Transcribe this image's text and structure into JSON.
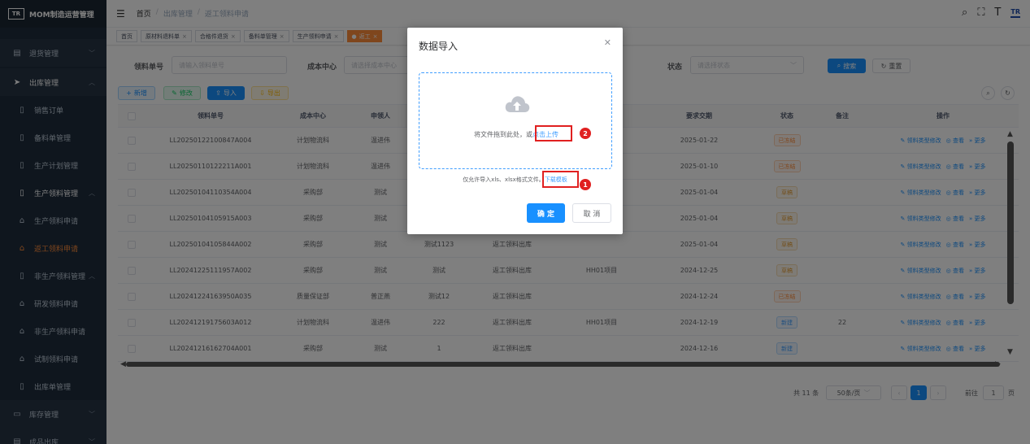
{
  "app": {
    "logo_mark": "TR",
    "title": "MOM制造运营管理"
  },
  "sidebar": {
    "items": [
      {
        "label": "退货管理",
        "icon": "list-icon"
      },
      {
        "label": "出库管理",
        "icon": "send-icon"
      },
      {
        "label": "销售订单",
        "icon": "doc-icon"
      },
      {
        "label": "备料单管理",
        "icon": "doc-icon"
      },
      {
        "label": "生产计划管理",
        "icon": "doc-icon"
      },
      {
        "label": "生产领料管理",
        "icon": "doc-icon"
      },
      {
        "label": "生产领料申请",
        "icon": "store-icon"
      },
      {
        "label": "返工领料申请",
        "icon": "store-icon"
      },
      {
        "label": "非生产领料管理",
        "icon": "doc-icon"
      },
      {
        "label": "研发领料申请",
        "icon": "store-icon"
      },
      {
        "label": "非生产领料申请",
        "icon": "store-icon"
      },
      {
        "label": "试制领料申请",
        "icon": "store-icon"
      },
      {
        "label": "出库单管理",
        "icon": "doc-icon"
      },
      {
        "label": "库存管理",
        "icon": "monitor-icon"
      },
      {
        "label": "成品出库",
        "icon": "list-icon"
      }
    ]
  },
  "header": {
    "breadcrumb": [
      "首页",
      "出库管理",
      "返工领料申请"
    ],
    "logo_mark": "TR"
  },
  "tags": [
    {
      "label": "首页",
      "closable": false
    },
    {
      "label": "原材料退料单",
      "closable": true
    },
    {
      "label": "合格件退货",
      "closable": true
    },
    {
      "label": "备料单管理",
      "closable": true
    },
    {
      "label": "生产领料申请",
      "closable": true
    },
    {
      "label": "返工",
      "closable": true
    }
  ],
  "search": {
    "order_label": "领料单号",
    "order_placeholder": "请输入领料单号",
    "cost_label": "成本中心",
    "cost_placeholder": "请选择成本中心",
    "status_label": "状态",
    "status_placeholder": "请选择状态",
    "search_btn": "搜索",
    "reset_btn": "重置"
  },
  "toolbar": {
    "add": "新增",
    "edit": "修改",
    "import": "导入",
    "export": "导出"
  },
  "table": {
    "columns": [
      "领料单号",
      "成本中心",
      "申领人",
      "要求交期",
      "状态",
      "备注",
      "操作"
    ],
    "rows": [
      {
        "no": "LL20250122100847A004",
        "cost": "计划物流科",
        "person": "温进伟",
        "c4": "",
        "c5": "",
        "c6": "",
        "date": "2025-01-22",
        "status": "已冻结",
        "status_kind": "frozen",
        "remark": ""
      },
      {
        "no": "LL20250110122211A001",
        "cost": "计划物流科",
        "person": "温进伟",
        "c4": "",
        "c5": "",
        "c6": "",
        "date": "2025-01-10",
        "status": "已冻结",
        "status_kind": "frozen",
        "remark": ""
      },
      {
        "no": "LL20250104110354A004",
        "cost": "采购部",
        "person": "测试",
        "c4": "",
        "c5": "",
        "c6": "",
        "date": "2025-01-04",
        "status": "草稿",
        "status_kind": "draft",
        "remark": ""
      },
      {
        "no": "LL20250104105915A003",
        "cost": "采购部",
        "person": "测试",
        "c4": "",
        "c5": "",
        "c6": "",
        "date": "2025-01-04",
        "status": "草稿",
        "status_kind": "draft",
        "remark": ""
      },
      {
        "no": "LL20250104105844A002",
        "cost": "采购部",
        "person": "测试",
        "c4": "测试1123",
        "c5": "返工领料出库",
        "c6": "",
        "date": "2025-01-04",
        "status": "草稿",
        "status_kind": "draft",
        "remark": ""
      },
      {
        "no": "LL20241225111957A002",
        "cost": "采购部",
        "person": "测试",
        "c4": "测试",
        "c5": "返工领料出库",
        "c6": "HH01项目",
        "date": "2024-12-25",
        "status": "草稿",
        "status_kind": "draft",
        "remark": ""
      },
      {
        "no": "LL20241224163950A035",
        "cost": "质量保证部",
        "person": "普正燕",
        "c4": "测试12",
        "c5": "返工领料出库",
        "c6": "",
        "date": "2024-12-24",
        "status": "已冻结",
        "status_kind": "frozen",
        "remark": ""
      },
      {
        "no": "LL20241219175603A012",
        "cost": "计划物流科",
        "person": "温进伟",
        "c4": "222",
        "c5": "返工领料出库",
        "c6": "HH01项目",
        "date": "2024-12-19",
        "status": "新建",
        "status_kind": "new",
        "remark": "22"
      },
      {
        "no": "LL20241216162704A001",
        "cost": "采购部",
        "person": "测试",
        "c4": "1",
        "c5": "返工领料出库",
        "c6": "",
        "date": "2024-12-16",
        "status": "新建",
        "status_kind": "new",
        "remark": ""
      }
    ],
    "ops": {
      "edit_type": "领料类型修改",
      "view": "查看",
      "more": "更多"
    }
  },
  "pager": {
    "total": "共 11 条",
    "page_size": "50条/页",
    "current": "1",
    "goto": "前往",
    "goto_value": "1",
    "page_suffix": "页"
  },
  "modal": {
    "title": "数据导入",
    "drop_text": "将文件拖到此处，或",
    "drop_link": "点击上传",
    "tip_text": "仅允许导入xls、xlsx格式文件。",
    "tip_link": "下载模板",
    "confirm": "确 定",
    "cancel": "取 消",
    "marker1": "1",
    "marker2": "2"
  },
  "colors": {
    "primary": "#1890ff",
    "sidebar": "#1f2d3d",
    "active": "#ff8c3a",
    "marker": "#e02020"
  }
}
